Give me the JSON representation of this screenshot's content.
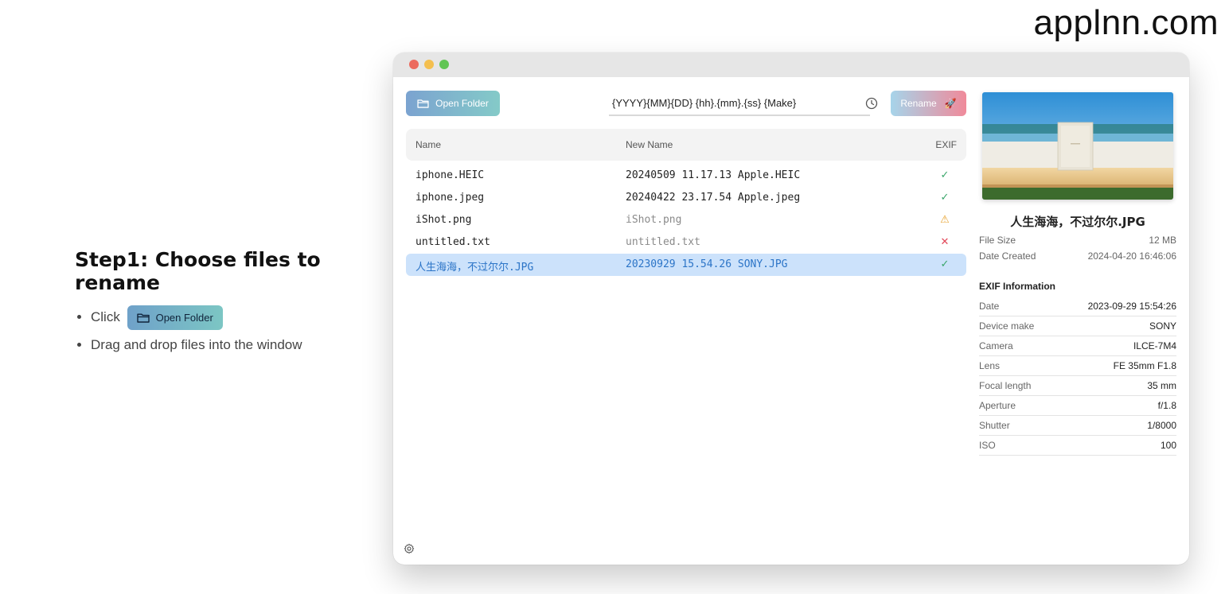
{
  "brand": "applnn.com",
  "steps": {
    "title": "Step1: Choose files to rename",
    "items": [
      {
        "prefix": "Click",
        "button_label": "Open Folder"
      },
      {
        "text": "Drag and drop files into the window"
      }
    ]
  },
  "toolbar": {
    "open_folder_label": "Open Folder",
    "pattern_value": "{YYYY}{MM}{DD} {hh}.{mm}.{ss} {Make}",
    "rename_label": "Rename",
    "rename_icon": "🚀"
  },
  "table": {
    "headers": {
      "name": "Name",
      "new_name": "New Name",
      "exif": "EXIF"
    },
    "rows": [
      {
        "name": "iphone.HEIC",
        "new_name": "20240509 11.17.13 Apple.HEIC",
        "status": "ok",
        "status_icon": "✓"
      },
      {
        "name": "iphone.jpeg",
        "new_name": "20240422 23.17.54 Apple.jpeg",
        "status": "ok",
        "status_icon": "✓"
      },
      {
        "name": "iShot.png",
        "new_name": "iShot.png",
        "status": "warn",
        "status_icon": "⚠"
      },
      {
        "name": "untitled.txt",
        "new_name": "untitled.txt",
        "status": "err",
        "status_icon": "✕"
      },
      {
        "name": "人生海海，不过尔尔.JPG",
        "new_name": "20230929 15.54.26 SONY.JPG",
        "status": "ok",
        "status_icon": "✓"
      }
    ]
  },
  "details": {
    "file_name": "人生海海，不过尔尔.JPG",
    "file_size_label": "File Size",
    "file_size": "12 MB",
    "date_created_label": "Date Created",
    "date_created": "2024-04-20 16:46:06",
    "exif_title": "EXIF Information",
    "exif": [
      {
        "k": "Date",
        "v": "2023-09-29 15:54:26"
      },
      {
        "k": "Device make",
        "v": "SONY"
      },
      {
        "k": "Camera",
        "v": "ILCE-7M4"
      },
      {
        "k": "Lens",
        "v": "FE 35mm F1.8"
      },
      {
        "k": "Focal length",
        "v": "35 mm"
      },
      {
        "k": "Aperture",
        "v": "f/1.8"
      },
      {
        "k": "Shutter",
        "v": "1/8000"
      },
      {
        "k": "ISO",
        "v": "100"
      }
    ]
  },
  "colors": {
    "ok": "#3aa66a",
    "warn": "#e7a22f",
    "err": "#e2495a",
    "selected_row": "#cce2fb",
    "selected_text": "#2b74c7"
  }
}
